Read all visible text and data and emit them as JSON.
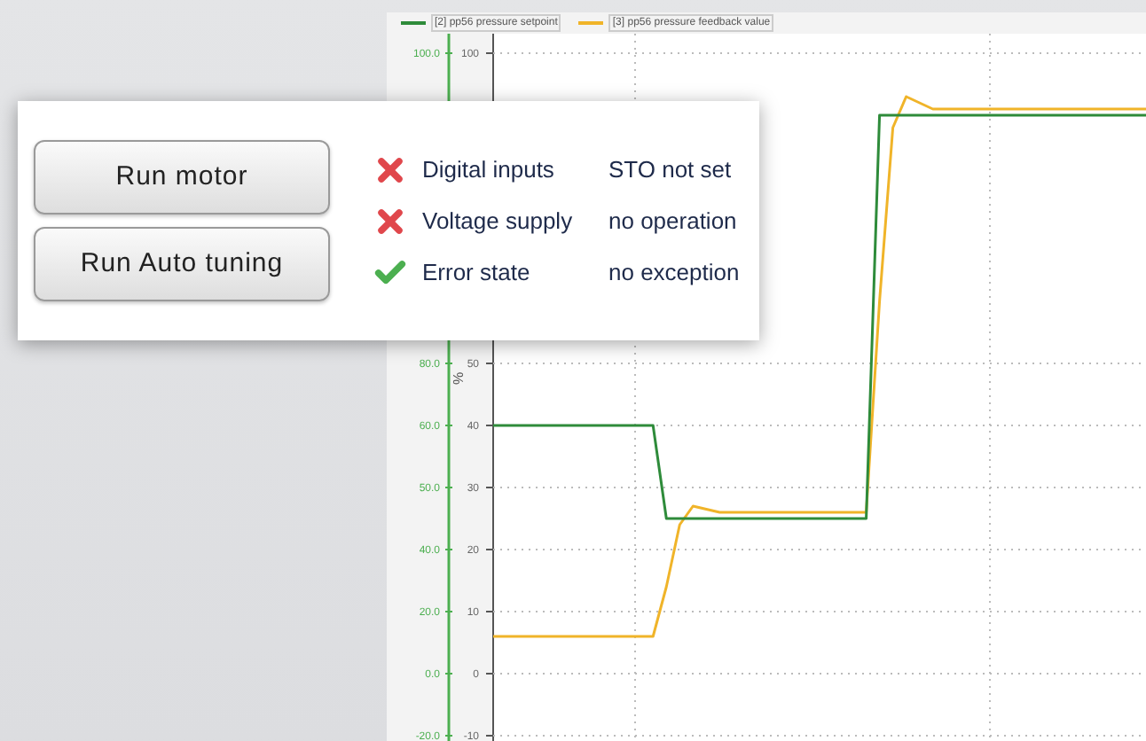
{
  "chart": {
    "secondary_axis": {
      "labels": [
        "100.0",
        "80.0",
        "60.0",
        "50.0",
        "40.0",
        "20.0",
        "0.0",
        "-20.0"
      ]
    },
    "chart_data": {
      "type": "line",
      "grid": true,
      "ylabel": "%",
      "ylim": [
        -10,
        100
      ],
      "yticks": [
        100,
        50,
        40,
        30,
        20,
        10,
        0,
        -10
      ],
      "series": [
        {
          "name": "[2] pp56 pressure setpoint",
          "color": "#2e8b3a",
          "values": [
            40,
            40,
            40,
            40,
            40,
            40,
            40,
            40,
            40,
            40,
            40,
            40,
            40,
            25,
            25,
            25,
            25,
            25,
            25,
            25,
            25,
            25,
            25,
            25,
            25,
            25,
            25,
            25,
            25,
            90,
            90,
            90,
            90,
            90,
            90,
            90,
            90,
            90,
            90,
            90,
            90,
            90,
            90,
            90,
            90,
            90,
            90,
            90,
            90,
            90
          ]
        },
        {
          "name": "[3] pp56 pressure feedback value",
          "color": "#f0b429",
          "values": [
            6,
            6,
            6,
            6,
            6,
            6,
            6,
            6,
            6,
            6,
            6,
            6,
            6,
            14,
            24,
            27,
            26.5,
            26,
            26,
            26,
            26,
            26,
            26,
            26,
            26,
            26,
            26,
            26,
            26,
            60,
            88,
            93,
            92,
            91,
            91,
            91,
            91,
            91,
            91,
            91,
            91,
            91,
            91,
            91,
            91,
            91,
            91,
            91,
            91,
            91
          ]
        }
      ]
    }
  },
  "panel": {
    "buttons": [
      "Run motor",
      "Run Auto tuning"
    ],
    "status": [
      {
        "label": "Digital inputs",
        "value": "STO not set",
        "kind": "error"
      },
      {
        "label": "Voltage supply",
        "value": "no operation",
        "kind": "error"
      },
      {
        "label": "Error state",
        "value": "no exception",
        "kind": "ok"
      }
    ]
  }
}
